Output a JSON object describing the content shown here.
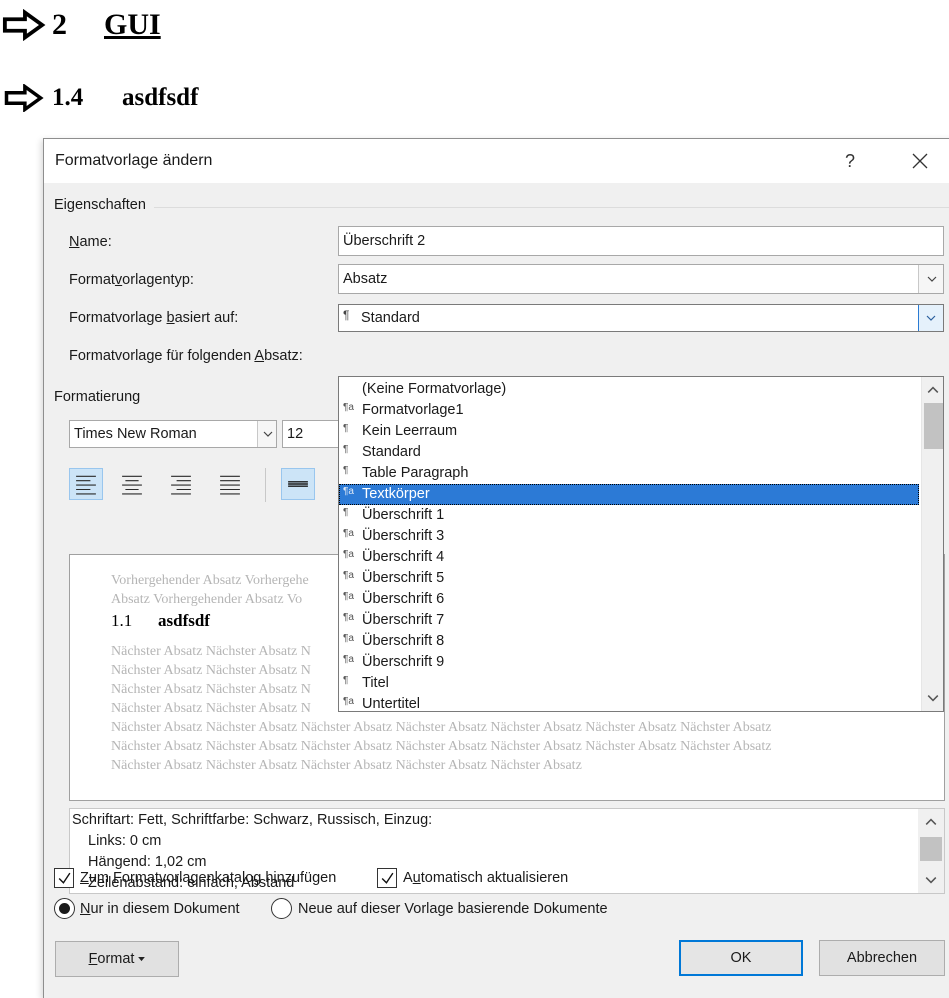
{
  "document": {
    "heading1": {
      "number": "2",
      "text": "GUI"
    },
    "heading2": {
      "number": "1.4",
      "text": "asdfsdf"
    }
  },
  "dialog": {
    "title": "Formatvorlage ändern",
    "help_glyph": "?",
    "close_glyph": "✕",
    "properties": {
      "group_title": "Eigenschaften",
      "name_label_u": "N",
      "name_label_rest": "ame:",
      "name_value": "Überschrift 2",
      "type_label_pre": "Format",
      "type_label_u": "v",
      "type_label_rest": "orlagentyp:",
      "type_value": "Absatz",
      "based_label_pre": "Formatvorlage ",
      "based_label_u": "b",
      "based_label_rest": "asiert auf:",
      "based_value": "Standard",
      "next_label_pre": "Formatvorlage für folgenden ",
      "next_label_u": "A",
      "next_label_rest": "bsatz:"
    },
    "dropdown": {
      "items": [
        {
          "icon": "",
          "label": "(Keine Formatvorlage)"
        },
        {
          "icon": "¶a",
          "label": "Formatvorlage1"
        },
        {
          "icon": "¶",
          "label": "Kein Leerraum"
        },
        {
          "icon": "¶",
          "label": "Standard"
        },
        {
          "icon": "¶",
          "label": "Table Paragraph"
        },
        {
          "icon": "¶a",
          "label": "Textkörper"
        },
        {
          "icon": "¶",
          "label": "Überschrift 1"
        },
        {
          "icon": "¶a",
          "label": "Überschrift 3"
        },
        {
          "icon": "¶a",
          "label": "Überschrift 4"
        },
        {
          "icon": "¶a",
          "label": "Überschrift 5"
        },
        {
          "icon": "¶a",
          "label": "Überschrift 6"
        },
        {
          "icon": "¶a",
          "label": "Überschrift 7"
        },
        {
          "icon": "¶a",
          "label": "Überschrift 8"
        },
        {
          "icon": "¶a",
          "label": "Überschrift 9"
        },
        {
          "icon": "¶",
          "label": "Titel"
        },
        {
          "icon": "¶a",
          "label": "Untertitel"
        }
      ],
      "selected_index": 5
    },
    "formatting": {
      "group_title": "Formatierung",
      "font": "Times New Roman",
      "size": "12"
    },
    "preview": {
      "prev_line1": "Vorhergehender Absatz Vorhergehe",
      "prev_line2": "Absatz Vorhergehender Absatz Vo",
      "heading_number": "1.1",
      "heading_text": "asdfsdf",
      "next_short": "Nächster Absatz Nächster Absatz N",
      "next_long": "Nächster Absatz Nächster Absatz Nächster Absatz Nächster Absatz Nächster Absatz Nächster Absatz Nächster Absatz",
      "next_last": "Nächster Absatz Nächster Absatz Nächster Absatz Nächster Absatz Nächster Absatz"
    },
    "description": {
      "line1": "Schriftart: Fett, Schriftfarbe: Schwarz, Russisch, Einzug:",
      "line2": "Links:  0 cm",
      "line3": "Hängend:  1,02 cm",
      "line4": "Zeilenabstand:  einfach, Abstand"
    },
    "options": {
      "add_gallery_u": "Z",
      "add_gallery_rest": "um Formatvorlagenkatalog hinzufügen",
      "add_gallery_checked": true,
      "auto_update_pre": "A",
      "auto_update_u": "u",
      "auto_update_rest": "tomatisch aktualisieren",
      "auto_update_checked": true,
      "only_doc_u": "N",
      "only_doc_rest": "ur in diesem Dokument",
      "only_doc_selected": true,
      "new_docs": "Neue auf dieser Vorlage basierende Dokumente",
      "new_docs_selected": false
    },
    "buttons": {
      "format_u": "F",
      "format_rest": "ormat",
      "ok": "OK",
      "cancel": "Abbrechen"
    }
  }
}
